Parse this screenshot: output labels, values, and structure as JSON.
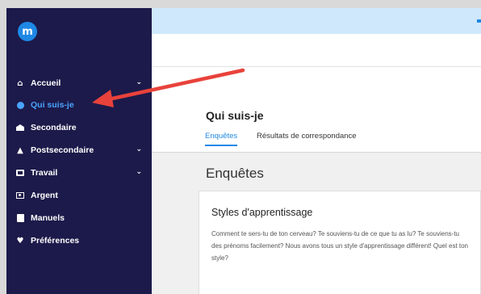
{
  "logo": {
    "glyph": "m"
  },
  "sidebar": {
    "items": [
      {
        "label": "Accueil",
        "icon": "home-icon",
        "has_chevron": true,
        "active": false
      },
      {
        "label": "Qui suis-je",
        "icon": "person-circle-icon",
        "has_chevron": false,
        "active": true
      },
      {
        "label": "Secondaire",
        "icon": "school-building-icon",
        "has_chevron": false,
        "active": false
      },
      {
        "label": "Postsecondaire",
        "icon": "graduation-cap-icon",
        "has_chevron": true,
        "active": false
      },
      {
        "label": "Travail",
        "icon": "briefcase-icon",
        "has_chevron": true,
        "active": false
      },
      {
        "label": "Argent",
        "icon": "money-icon",
        "has_chevron": false,
        "active": false
      },
      {
        "label": "Manuels",
        "icon": "book-icon",
        "has_chevron": false,
        "active": false
      },
      {
        "label": "Préférences",
        "icon": "heart-icon",
        "has_chevron": false,
        "active": false
      }
    ]
  },
  "page": {
    "title": "Qui suis-je",
    "tabs": [
      {
        "label": "Enquêtes",
        "active": true
      },
      {
        "label": "Résultats de correspondance",
        "active": false
      }
    ]
  },
  "section": {
    "title": "Enquêtes",
    "card": {
      "title": "Styles d'apprentissage",
      "description": "Comment te sers-tu de ton cerveau? Te souviens-tu de ce que tu as lu? Te souviens-tu des prénoms facilement? Nous avons tous un style d'apprentissage différent! Quel est ton style?"
    }
  },
  "colors": {
    "sidebar_bg": "#1c1a4a",
    "accent": "#1e88e5",
    "active_nav": "#4aa3ff",
    "topbar": "#cfe8fb",
    "annotation_arrow": "#e8423b"
  }
}
